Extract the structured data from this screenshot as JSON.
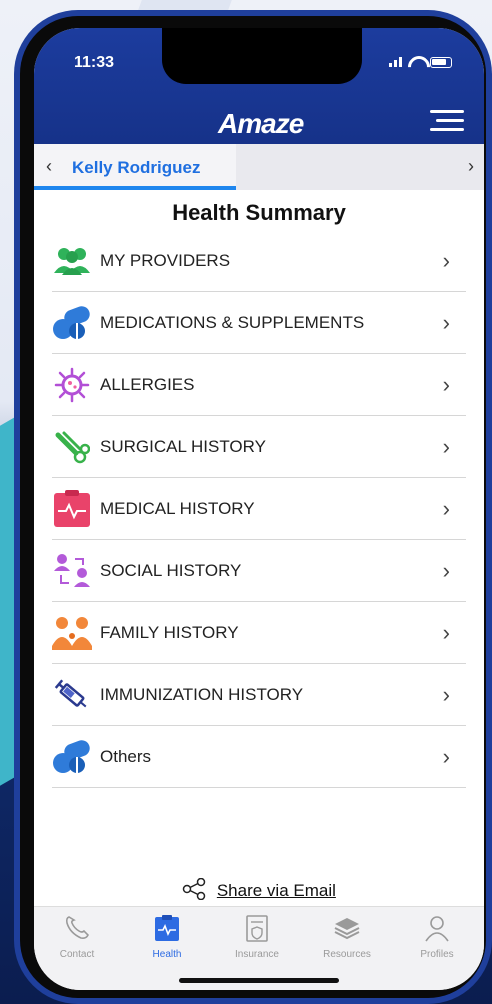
{
  "status": {
    "time": "11:33"
  },
  "header": {
    "logo": "Amaze"
  },
  "profile": {
    "name": "Kelly Rodriguez"
  },
  "page_title": "Health Summary",
  "items": [
    {
      "label": "MY PROVIDERS",
      "icon": "providers-icon",
      "color": "#2fb25a"
    },
    {
      "label": "MEDICATIONS & SUPPLEMENTS",
      "icon": "pills-icon",
      "color": "#2f7bd9"
    },
    {
      "label": "ALLERGIES",
      "icon": "virus-icon",
      "color": "#b24fd6"
    },
    {
      "label": "SURGICAL HISTORY",
      "icon": "scissors-icon",
      "color": "#38b24a"
    },
    {
      "label": "MEDICAL HISTORY",
      "icon": "clipboard-icon",
      "color": "#e9436a"
    },
    {
      "label": "SOCIAL HISTORY",
      "icon": "social-icon",
      "color": "#b35ad9"
    },
    {
      "label": "FAMILY HISTORY",
      "icon": "family-icon",
      "color": "#f2873a"
    },
    {
      "label": "IMMUNIZATION HISTORY",
      "icon": "syringe-icon",
      "color": "#2b3a8f"
    },
    {
      "label": "Others",
      "icon": "pills-icon",
      "color": "#2f7bd9"
    }
  ],
  "share": {
    "label": "Share via Email"
  },
  "tabs": [
    {
      "label": "Contact",
      "icon": "phone-icon"
    },
    {
      "label": "Health",
      "icon": "health-icon",
      "active": true
    },
    {
      "label": "Insurance",
      "icon": "insurance-icon"
    },
    {
      "label": "Resources",
      "icon": "layers-icon"
    },
    {
      "label": "Profiles",
      "icon": "user-icon"
    }
  ],
  "colors": {
    "brand": "#1c3c9e",
    "accent": "#1f86ee"
  }
}
